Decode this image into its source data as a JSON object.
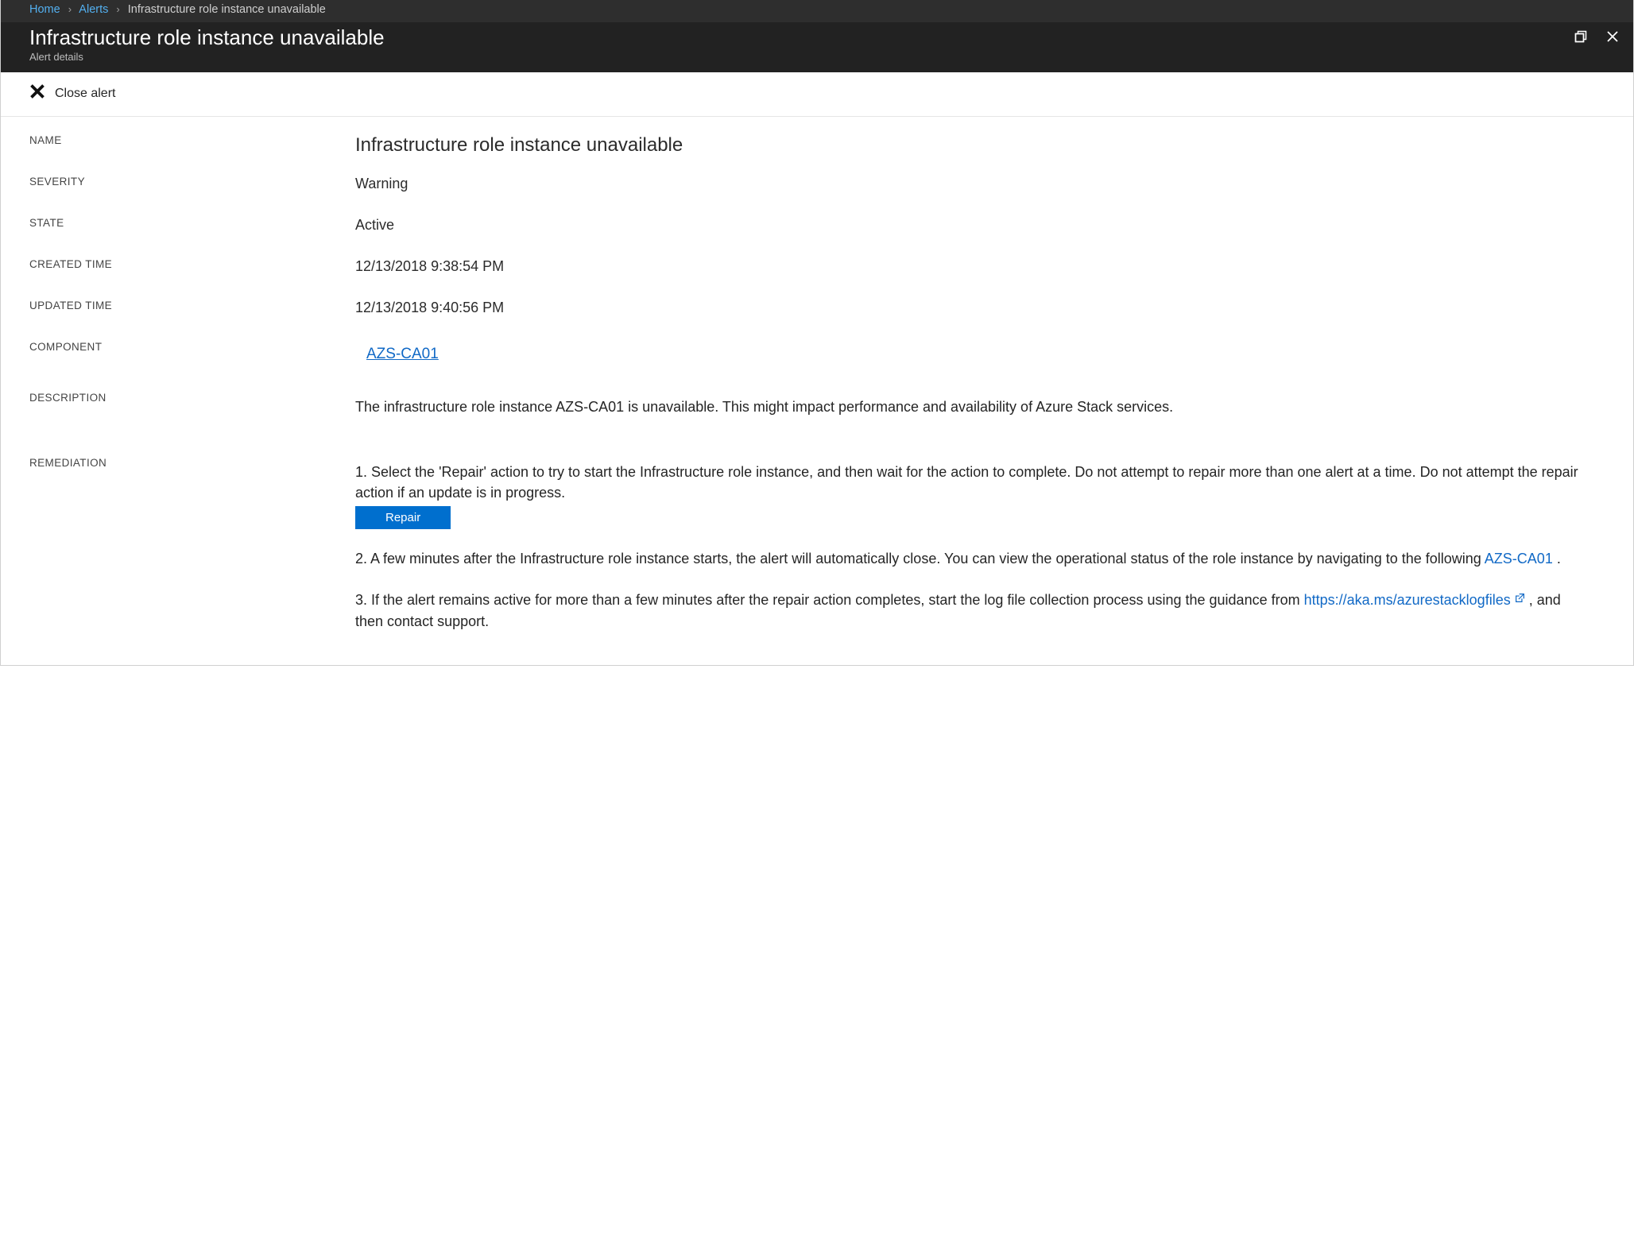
{
  "breadcrumb": {
    "home": "Home",
    "alerts": "Alerts",
    "current": "Infrastructure role instance unavailable"
  },
  "header": {
    "title": "Infrastructure role instance unavailable",
    "subtitle": "Alert details"
  },
  "toolbar": {
    "close_label": "Close alert"
  },
  "labels": {
    "name": "NAME",
    "severity": "SEVERITY",
    "state": "STATE",
    "created": "CREATED TIME",
    "updated": "UPDATED TIME",
    "component": "COMPONENT",
    "description": "DESCRIPTION",
    "remediation": "REMEDIATION"
  },
  "values": {
    "name": "Infrastructure role instance unavailable",
    "severity": "Warning",
    "state": "Active",
    "created": "12/13/2018 9:38:54 PM",
    "updated": "12/13/2018 9:40:56 PM",
    "component": "AZS-CA01",
    "description": "The infrastructure role instance AZS-CA01 is unavailable. This might impact performance and availability of Azure Stack services."
  },
  "remediation": {
    "step1": "1. Select the 'Repair' action to try to start the Infrastructure role instance, and then wait for the action to complete. Do not attempt to repair more than one alert at a time. Do not attempt the repair action if an update is in progress.",
    "repair_btn": "Repair",
    "step2a": "2. A few minutes after the Infrastructure role instance starts, the alert will automatically close. You can view the operational status of the role instance by navigating to the following ",
    "step2_link": "AZS-CA01",
    "step2b": " .",
    "step3a": "3. If the alert remains active for more than a few minutes after the repair action completes, start the log file collection process using the guidance from ",
    "step3_link": "https://aka.ms/azurestacklogfiles",
    "step3b": " , and then contact support."
  }
}
